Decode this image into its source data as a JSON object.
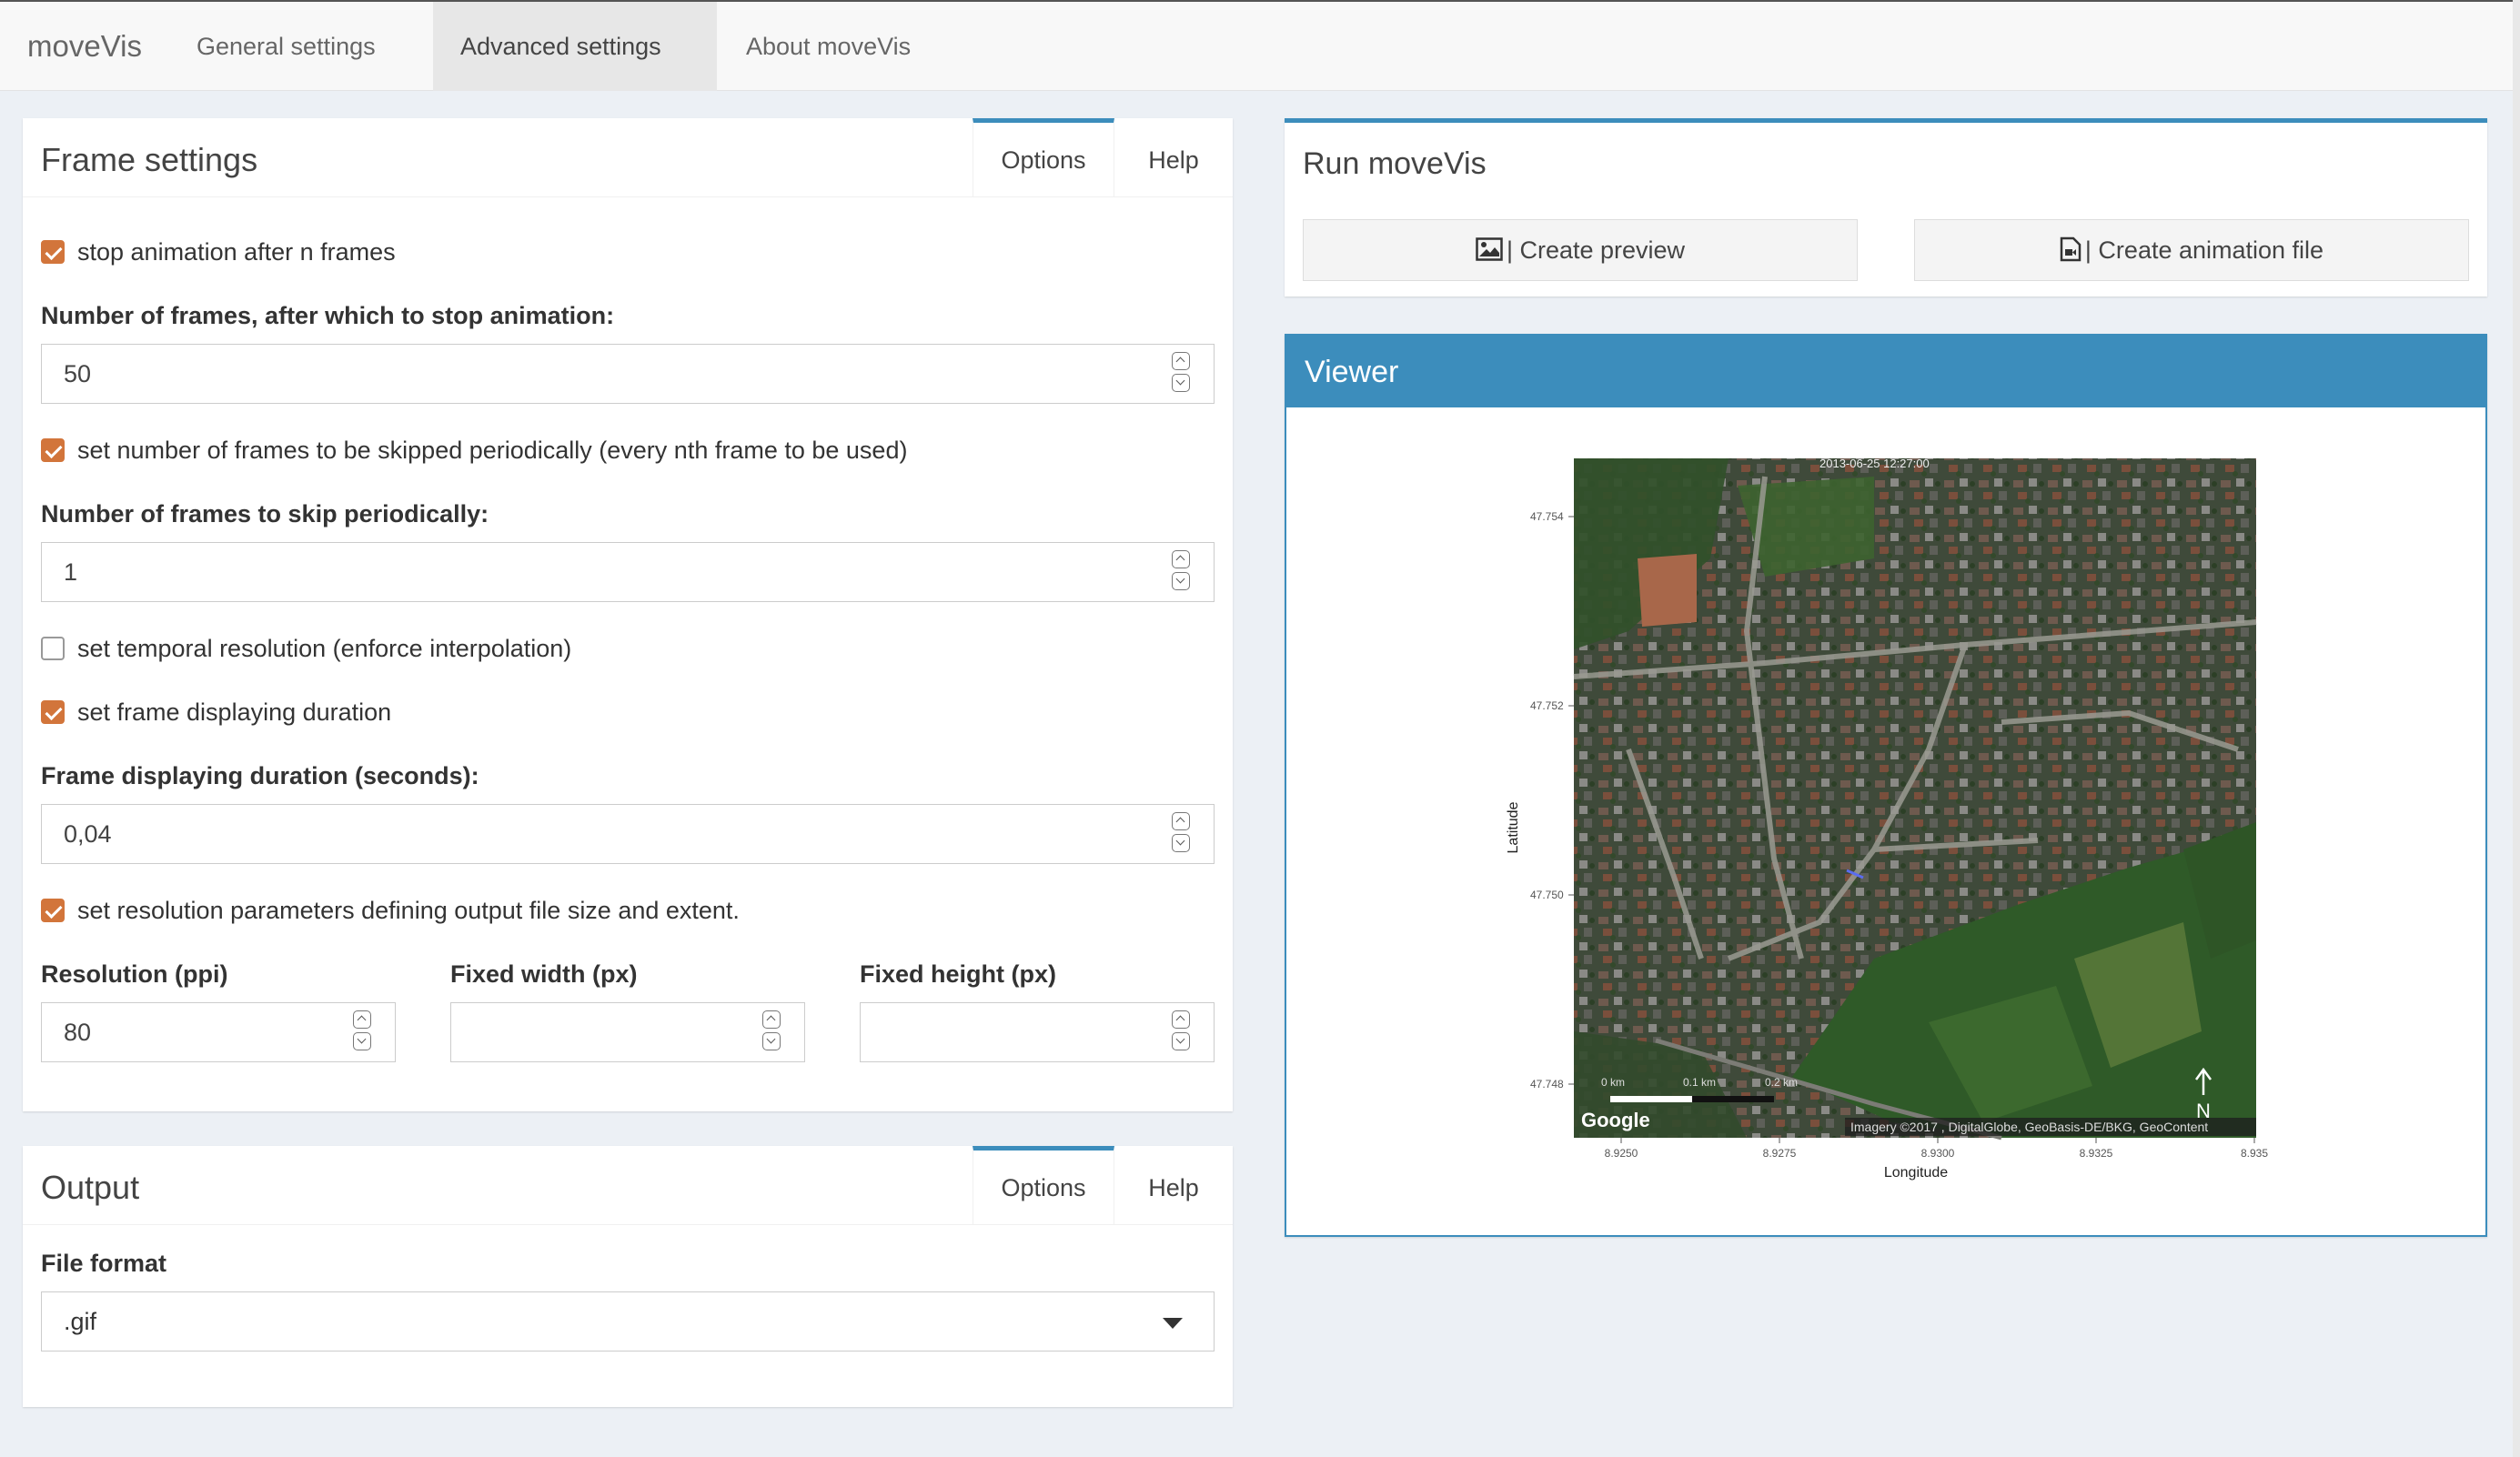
{
  "navbar": {
    "brand": "moveVis",
    "tabs": [
      {
        "label": "General settings",
        "icon": "sliders-icon"
      },
      {
        "label": "Advanced settings",
        "icon": "magic-wand-icon",
        "active": true
      },
      {
        "label": "About moveVis",
        "icon": "info-circle-icon"
      }
    ]
  },
  "frame_settings": {
    "title": "Frame settings",
    "tab_options": "Options",
    "tab_help": "Help",
    "stop_after_n": {
      "label": "stop animation after n frames",
      "checked": true
    },
    "num_frames_label": "Number of frames, after which to stop animation:",
    "num_frames_value": "50",
    "skip_periodically": {
      "label": "set number of frames to be skipped periodically (every nth frame to be used)",
      "checked": true
    },
    "skip_label": "Number of frames to skip periodically:",
    "skip_value": "1",
    "temporal_resolution": {
      "label": "set temporal resolution (enforce interpolation)",
      "checked": false
    },
    "frame_duration": {
      "label": "set frame displaying duration",
      "checked": true
    },
    "duration_label": "Frame displaying duration (seconds):",
    "duration_value": "0,04",
    "resolution_params": {
      "label": "set resolution parameters defining output file size and extent.",
      "checked": true
    },
    "resolution_label": "Resolution (ppi)",
    "resolution_value": "80",
    "width_label": "Fixed width (px)",
    "width_value": "",
    "height_label": "Fixed height (px)",
    "height_value": ""
  },
  "output": {
    "title": "Output",
    "tab_options": "Options",
    "tab_help": "Help",
    "file_format_label": "File format",
    "file_format_value": ".gif"
  },
  "run": {
    "title": "Run moveVis",
    "preview_label": "| Create preview",
    "preview_icon": "image-icon",
    "animation_label": "| Create animation file",
    "animation_icon": "file-video-icon"
  },
  "viewer": {
    "title": "Viewer",
    "plot": {
      "timestamp": "2013-06-25 12:27:00",
      "y_axis_label": "Latitude",
      "x_axis_label": "Longitude",
      "y_ticks": [
        "47.754",
        "47.752",
        "47.750",
        "47.748"
      ],
      "x_ticks": [
        "8.9250",
        "8.9275",
        "8.9300",
        "8.9325",
        "8.935"
      ],
      "scale_labels": [
        "0 km",
        "0.1 km",
        "0.2 km"
      ],
      "north_label": "N",
      "google_logo": "Google",
      "attribution": "Imagery ©2017 , DigitalGlobe, GeoBasis-DE/BKG, GeoContent"
    }
  },
  "colors": {
    "accent": "#3c8dbc",
    "checkbox": "#d2753b",
    "background": "#ecf0f5"
  }
}
